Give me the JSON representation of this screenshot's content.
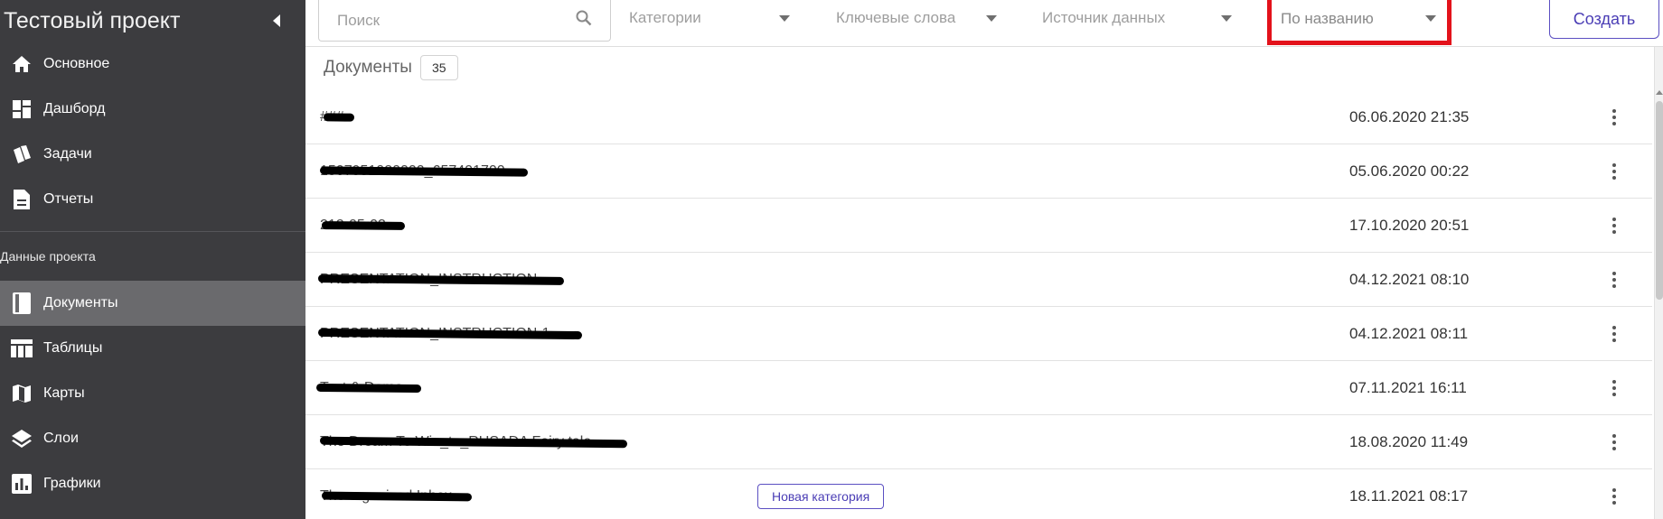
{
  "sidebar": {
    "title": "Тестовый проект",
    "section_label": "Данные проекта",
    "items_top": [
      {
        "label": "Основное",
        "icon": "home-icon"
      },
      {
        "label": "Дашборд",
        "icon": "dashboard-icon"
      },
      {
        "label": "Задачи",
        "icon": "tasks-icon"
      },
      {
        "label": "Отчеты",
        "icon": "report-icon"
      }
    ],
    "items_project": [
      {
        "label": "Документы",
        "icon": "document-icon",
        "active": true
      },
      {
        "label": "Таблицы",
        "icon": "table-icon"
      },
      {
        "label": "Карты",
        "icon": "map-icon"
      },
      {
        "label": "Слои",
        "icon": "layers-icon"
      },
      {
        "label": "Графики",
        "icon": "chart-icon"
      }
    ]
  },
  "toolbar": {
    "search_placeholder": "Поиск",
    "filter_categories": "Категории",
    "filter_keywords": "Ключевые слова",
    "filter_source": "Источник данных",
    "sort_selected": "По названию",
    "create_label": "Создать"
  },
  "documents": {
    "title": "Документы",
    "count": "35",
    "rows": [
      {
        "name": "###",
        "date": "06.06.2020 21:35",
        "tag": ""
      },
      {
        "name": "1507951020000_657401700",
        "date": "05.06.2020 00:22",
        "tag": ""
      },
      {
        "name": "212-05-03",
        "date": "17.10.2020 20:51",
        "tag": ""
      },
      {
        "name": "PRESENTATION_INSTRUCTION",
        "date": "04.12.2021 08:10",
        "tag": ""
      },
      {
        "name": "PRESENTATION_INSTRUCTION-1",
        "date": "04.12.2021 08:11",
        "tag": ""
      },
      {
        "name": "Test & Demo",
        "date": "07.11.2021 16:11",
        "tag": ""
      },
      {
        "name": "The Dream To Win_to_RUSADA Fairy tale",
        "date": "18.08.2020 11:49",
        "tag": ""
      },
      {
        "name": "The organized Inbox",
        "date": "18.11.2021 08:17",
        "tag": "Новая категория"
      }
    ]
  },
  "colors": {
    "sidebar_bg": "#3c3c3f",
    "sidebar_active": "#6a6a6d",
    "accent": "#5b4fc2",
    "highlight_border": "#e3121b"
  }
}
